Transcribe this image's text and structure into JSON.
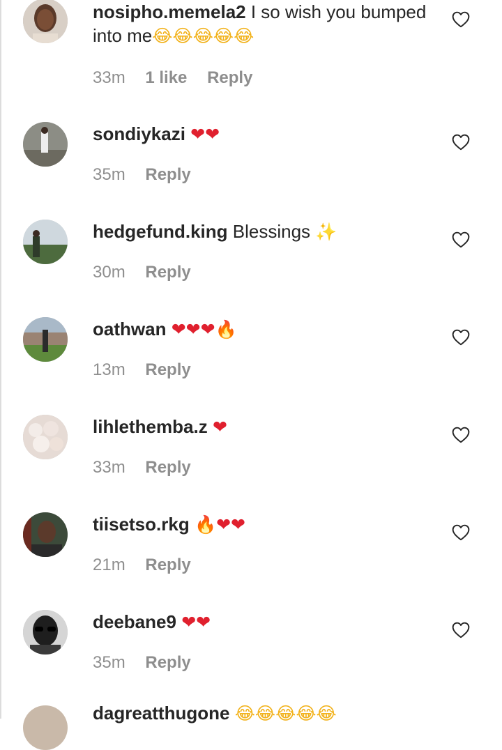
{
  "comments": [
    {
      "username": "nosipho.memela2",
      "text": "I so wish you bumped into me",
      "emoji": "😂😂😂😂😂",
      "time": "33m",
      "likes": "1 like",
      "reply": "Reply"
    },
    {
      "username": "sondiykazi",
      "text": "",
      "emoji": "❤❤",
      "time": "35m",
      "reply": "Reply"
    },
    {
      "username": "hedgefund.king",
      "text": "Blessings",
      "emoji": "✨",
      "time": "30m",
      "reply": "Reply"
    },
    {
      "username": "oathwan",
      "text": "",
      "emoji": "❤❤❤🔥",
      "time": "13m",
      "reply": "Reply"
    },
    {
      "username": "lihlethemba.z",
      "text": "",
      "emoji": "❤",
      "time": "33m",
      "reply": "Reply"
    },
    {
      "username": "tiisetso.rkg",
      "text": "",
      "emoji": "🔥❤❤",
      "time": "21m",
      "reply": "Reply"
    },
    {
      "username": "deebane9",
      "text": "",
      "emoji": "❤❤",
      "time": "35m",
      "reply": "Reply"
    }
  ],
  "partial_comment": {
    "username": "dagreatthugone",
    "emoji": "😂😂😂😂😂"
  },
  "colors": {
    "username": "#262626",
    "meta": "#8e8e8e",
    "heart_red": "#e0202e"
  },
  "icons": {
    "like": "heart-outline-icon"
  }
}
